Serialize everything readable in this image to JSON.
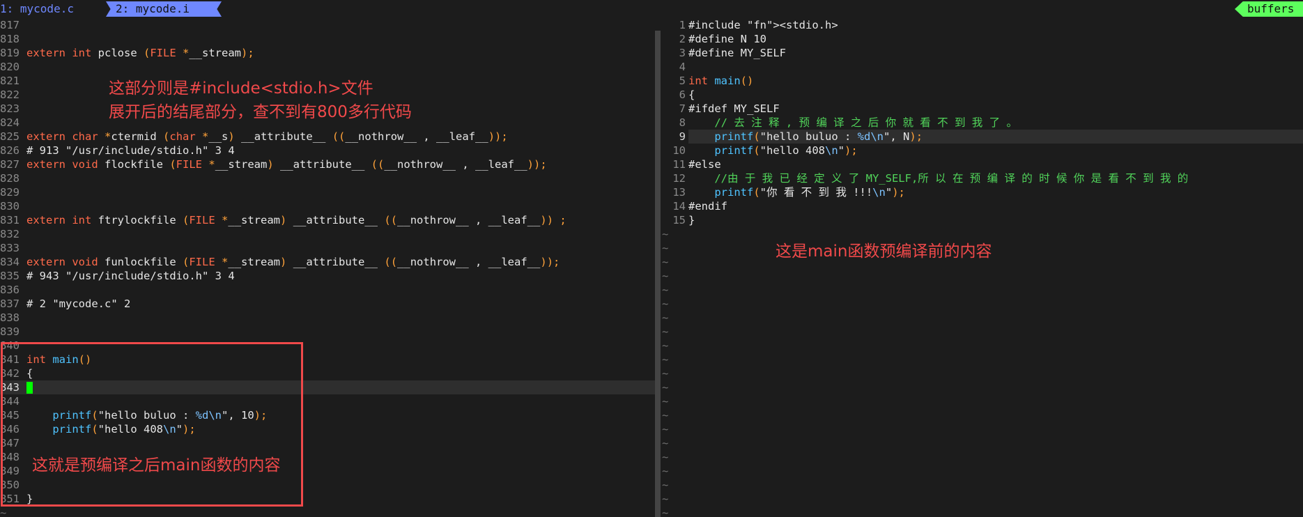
{
  "tabs": {
    "tab1": "1: mycode.c",
    "tab2": "2: mycode.i",
    "buffers": "buffers"
  },
  "left_pane": {
    "cursor_line": "843",
    "lines": [
      {
        "n": "817",
        "t": ""
      },
      {
        "n": "818",
        "t": ""
      },
      {
        "n": "819",
        "t": "extern int pclose (FILE *__stream);"
      },
      {
        "n": "820",
        "t": ""
      },
      {
        "n": "821",
        "t": ""
      },
      {
        "n": "822",
        "t": ""
      },
      {
        "n": "823",
        "t": ""
      },
      {
        "n": "824",
        "t": ""
      },
      {
        "n": "825",
        "t": "extern char *ctermid (char *__s) __attribute__ ((__nothrow__ , __leaf__));"
      },
      {
        "n": "826",
        "t": "# 913 \"/usr/include/stdio.h\" 3 4"
      },
      {
        "n": "827",
        "t": "extern void flockfile (FILE *__stream) __attribute__ ((__nothrow__ , __leaf__));"
      },
      {
        "n": "828",
        "t": ""
      },
      {
        "n": "829",
        "t": ""
      },
      {
        "n": "830",
        "t": ""
      },
      {
        "n": "831",
        "t": "extern int ftrylockfile (FILE *__stream) __attribute__ ((__nothrow__ , __leaf__)) ;"
      },
      {
        "n": "832",
        "t": ""
      },
      {
        "n": "833",
        "t": ""
      },
      {
        "n": "834",
        "t": "extern void funlockfile (FILE *__stream) __attribute__ ((__nothrow__ , __leaf__));"
      },
      {
        "n": "835",
        "t": "# 943 \"/usr/include/stdio.h\" 3 4"
      },
      {
        "n": "836",
        "t": ""
      },
      {
        "n": "837",
        "t": "# 2 \"mycode.c\" 2"
      },
      {
        "n": "838",
        "t": ""
      },
      {
        "n": "839",
        "t": ""
      },
      {
        "n": "840",
        "t": ""
      },
      {
        "n": "841",
        "t": "int main()"
      },
      {
        "n": "842",
        "t": "{"
      },
      {
        "n": "843",
        "t": ""
      },
      {
        "n": "844",
        "t": ""
      },
      {
        "n": "845",
        "t": "    printf(\"hello buluo : %d\\n\", 10);"
      },
      {
        "n": "846",
        "t": "    printf(\"hello 408\\n\");"
      },
      {
        "n": "847",
        "t": ""
      },
      {
        "n": "848",
        "t": ""
      },
      {
        "n": "849",
        "t": ""
      },
      {
        "n": "850",
        "t": ""
      },
      {
        "n": "851",
        "t": "}"
      },
      {
        "n": "~",
        "t": ""
      }
    ]
  },
  "right_pane": {
    "cursor_line": "9",
    "lines": [
      {
        "n": "1",
        "t": "#include <stdio.h>"
      },
      {
        "n": "2",
        "t": "#define N 10"
      },
      {
        "n": "3",
        "t": "#define MY_SELF"
      },
      {
        "n": "4",
        "t": ""
      },
      {
        "n": "5",
        "t": "int main()"
      },
      {
        "n": "6",
        "t": "{"
      },
      {
        "n": "7",
        "t": "#ifdef MY_SELF"
      },
      {
        "n": "8",
        "t": "    // 去 注 释 , 预 编 译 之 后 你 就 看 不 到 我 了 。"
      },
      {
        "n": "9",
        "t": "    printf(\"hello buluo : %d\\n\", N);"
      },
      {
        "n": "10",
        "t": "    printf(\"hello 408\\n\");"
      },
      {
        "n": "11",
        "t": "#else"
      },
      {
        "n": "12",
        "t": "    //由 于 我 已 经 定 义 了 MY_SELF,所 以 在 预 编 译 的 时 候 你 是 看 不 到 我 的"
      },
      {
        "n": "13",
        "t": "    printf(\"你 看 不 到 我 !!!\\n\");"
      },
      {
        "n": "14",
        "t": "#endif"
      },
      {
        "n": "15",
        "t": "}"
      }
    ],
    "tilde_count": 21
  },
  "annotations": {
    "top_line1": "这部分则是#include<stdio.h>文件",
    "top_line2": "展开后的结尾部分，查不到有800多行代码",
    "right": "这是main函数预编译前的内容",
    "box": "这就是预编译之后main函数的内容"
  },
  "colors": {
    "background": "#1c1c1c",
    "tab_active": "#6f88ff",
    "buffers_badge": "#5dff5d",
    "annotation": "#f0494a",
    "cursor": "#00ff00"
  }
}
